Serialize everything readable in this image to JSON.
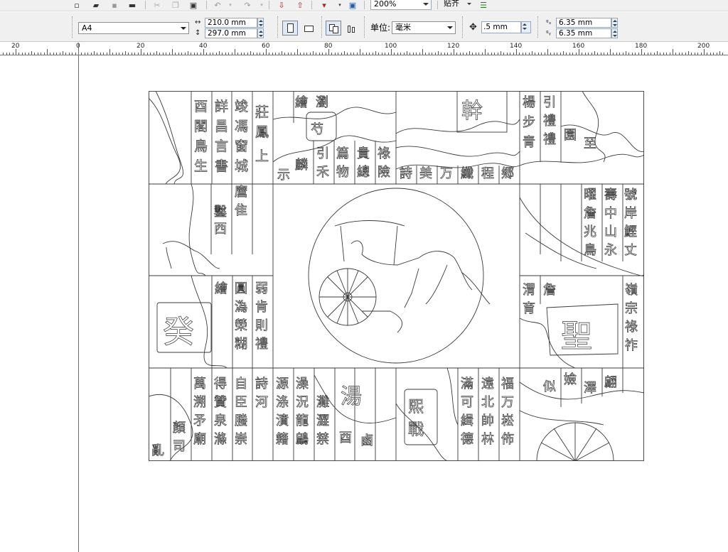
{
  "toolbar": {
    "zoom_value": "200%",
    "snap_label": "贴齐",
    "icons": [
      "new-doc-icon",
      "open-icon",
      "save-icon",
      "print-icon",
      "cut-icon",
      "copy-icon",
      "paste-icon",
      "undo-icon",
      "redo-icon",
      "import-icon",
      "export-icon",
      "publish-icon",
      "corel-connect-icon",
      "snap-options-icon"
    ]
  },
  "propbar": {
    "paper_size": "A4",
    "width_value": "210.0 mm",
    "height_value": "297.0 mm",
    "unit_label": "单位:",
    "unit_value": "毫米",
    "nudge_value": ".5 mm",
    "dup_x_value": "6.35 mm",
    "dup_y_value": "6.35 mm",
    "dup_x_icon": "ᵍₓ",
    "dup_y_icon": "ᵍᵧ"
  },
  "ruler": {
    "labels": [
      "20",
      "0",
      "20",
      "40",
      "60",
      "80",
      "100",
      "120",
      "140",
      "160",
      "180",
      "200"
    ]
  },
  "artwork": {
    "description_name": "chinese-seal-carving-artwork"
  }
}
